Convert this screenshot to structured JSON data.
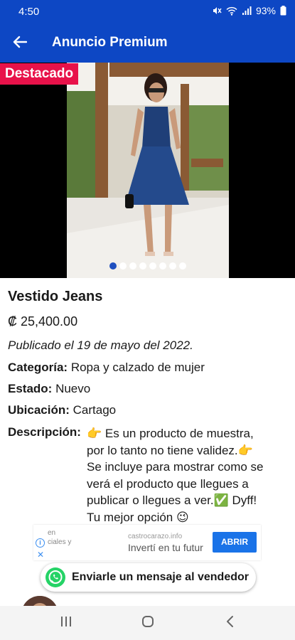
{
  "status_bar": {
    "time": "4:50",
    "battery": "93%"
  },
  "app_bar": {
    "title": "Anuncio Premium"
  },
  "gallery": {
    "badge": "Destacado",
    "image_count": 8,
    "active_index": 0
  },
  "product": {
    "title": "Vestido Jeans",
    "price": "₡ 25,400.00",
    "published": "Publicado el 19  de mayo del  2022.",
    "category_label": "Categoría:",
    "category_value": "Ropa y calzado de mujer",
    "state_label": "Estado:",
    "state_value": "Nuevo",
    "location_label": "Ubicación:",
    "location_value": "Cartago",
    "description_label": "Descripción:",
    "description_line1": "👉 Es un producto de muestra,",
    "description_line2": "por lo tanto no tiene validez.👉",
    "description_line3": "Se incluye para mostrar como se",
    "description_line4": "verá el producto que llegues a",
    "description_line5": "publicar o llegues a ver.✅ Dyff!",
    "description_line6": "Tu mejor opción 😉"
  },
  "ad": {
    "text_line1": "en",
    "text_line2": "ciales y",
    "domain": "castrocarazo.info",
    "headline": "Invertí en tu futur",
    "button": "ABRIR"
  },
  "whatsapp_button": {
    "label": "Enviarle un mensaje al vendedor"
  },
  "colors": {
    "primary": "#0d47c4",
    "badge": "#e8124a",
    "whatsapp": "#25d366",
    "ad_button": "#1a73e8"
  }
}
